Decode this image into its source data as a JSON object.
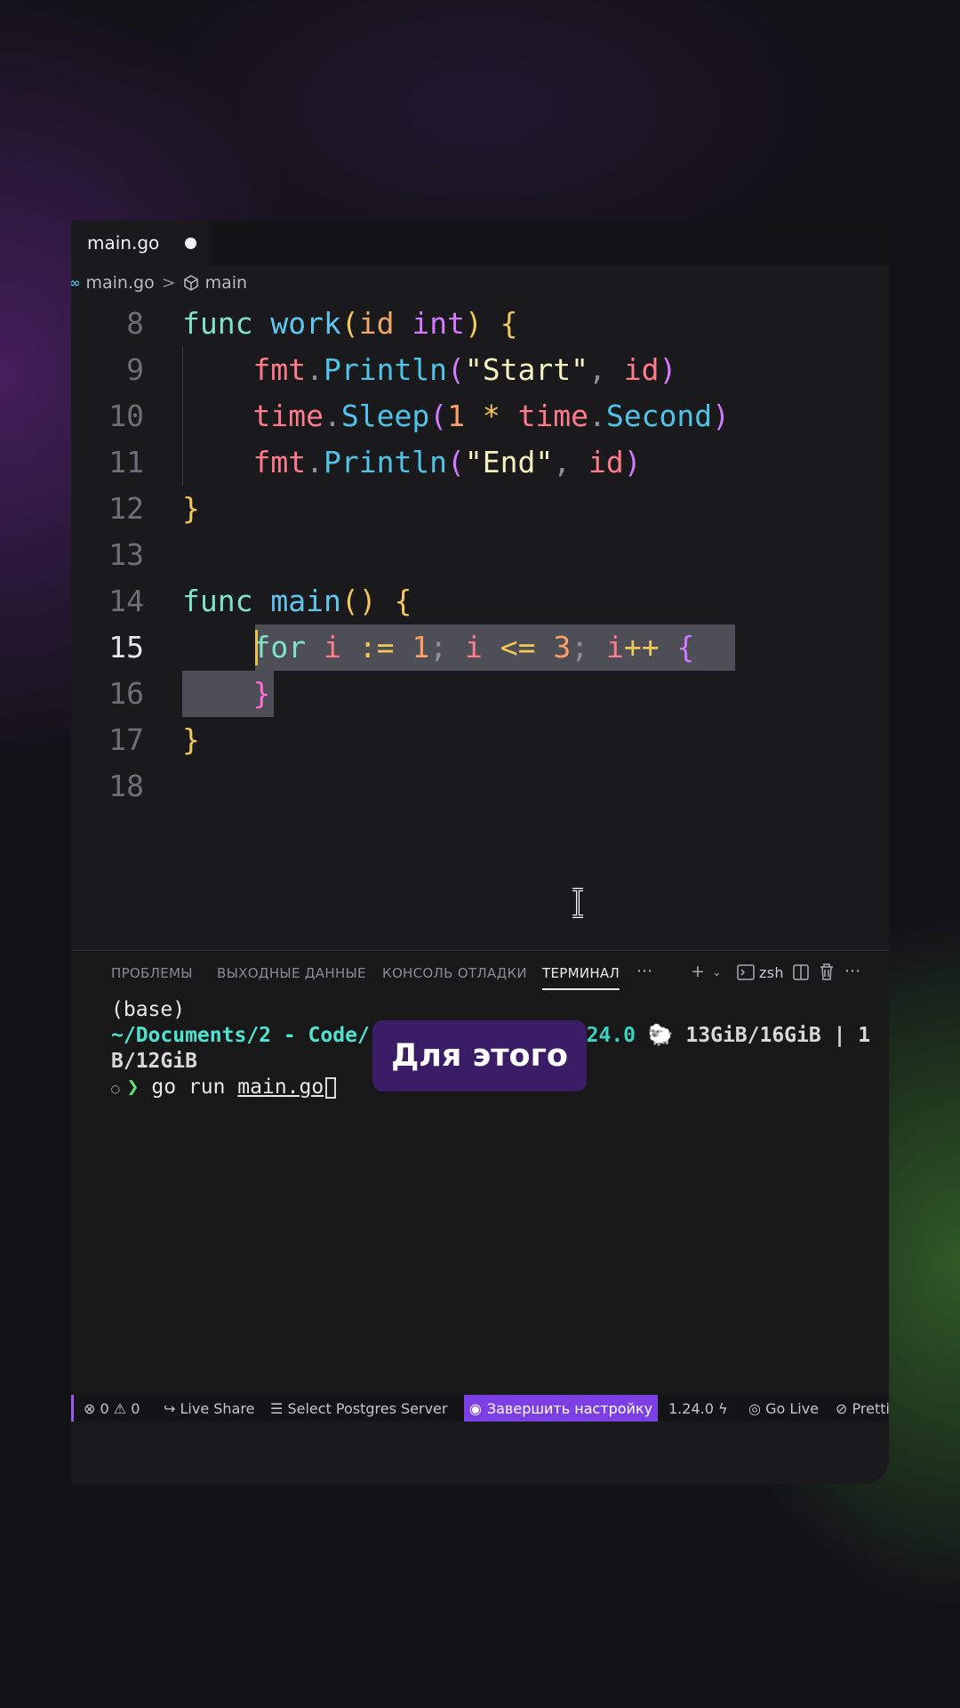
{
  "tab": {
    "filename": "main.go"
  },
  "breadcrumbs": {
    "file": "main.go",
    "symbol": "main",
    "separator": ">"
  },
  "editor": {
    "lines": [
      {
        "n": "8"
      },
      {
        "n": "9"
      },
      {
        "n": "10"
      },
      {
        "n": "11"
      },
      {
        "n": "12"
      },
      {
        "n": "13"
      },
      {
        "n": "14"
      },
      {
        "n": "15"
      },
      {
        "n": "16"
      },
      {
        "n": "17"
      },
      {
        "n": "18"
      }
    ]
  },
  "panel": {
    "tabs": [
      "ПРОБЛЕМЫ",
      "ВЫХОДНЫЕ ДАННЫЕ",
      "КОНСОЛЬ ОТЛАДКИ",
      "ТЕРМИНАЛ"
    ],
    "active_tab": "ТЕРМИНАЛ",
    "more": "···",
    "shell": "zsh"
  },
  "terminal": {
    "line1": "(base)",
    "path": "~/Documents/2 - Code/",
    "version_frag": ".24.0",
    "mem": "13GiB/16GiB | 1",
    "line3": "B/12GiB",
    "prompt_symbol": "❯",
    "command_prefix": "go run ",
    "command_file": "main.go"
  },
  "status": {
    "errors": "0",
    "warnings": "0",
    "live_share": "Live Share",
    "postgres": "Select Postgres Server",
    "finish_setup": "Завершить настройку",
    "go_version": "1.24.0",
    "go_live": "Go Live",
    "prettier": "Pretti"
  },
  "caption": {
    "text": "Для этого"
  },
  "colors": {
    "accent": "#7b3fe4",
    "caption_bg": "#3a1d66",
    "keyword": "#7fe3c6",
    "function": "#5fc6ef"
  }
}
